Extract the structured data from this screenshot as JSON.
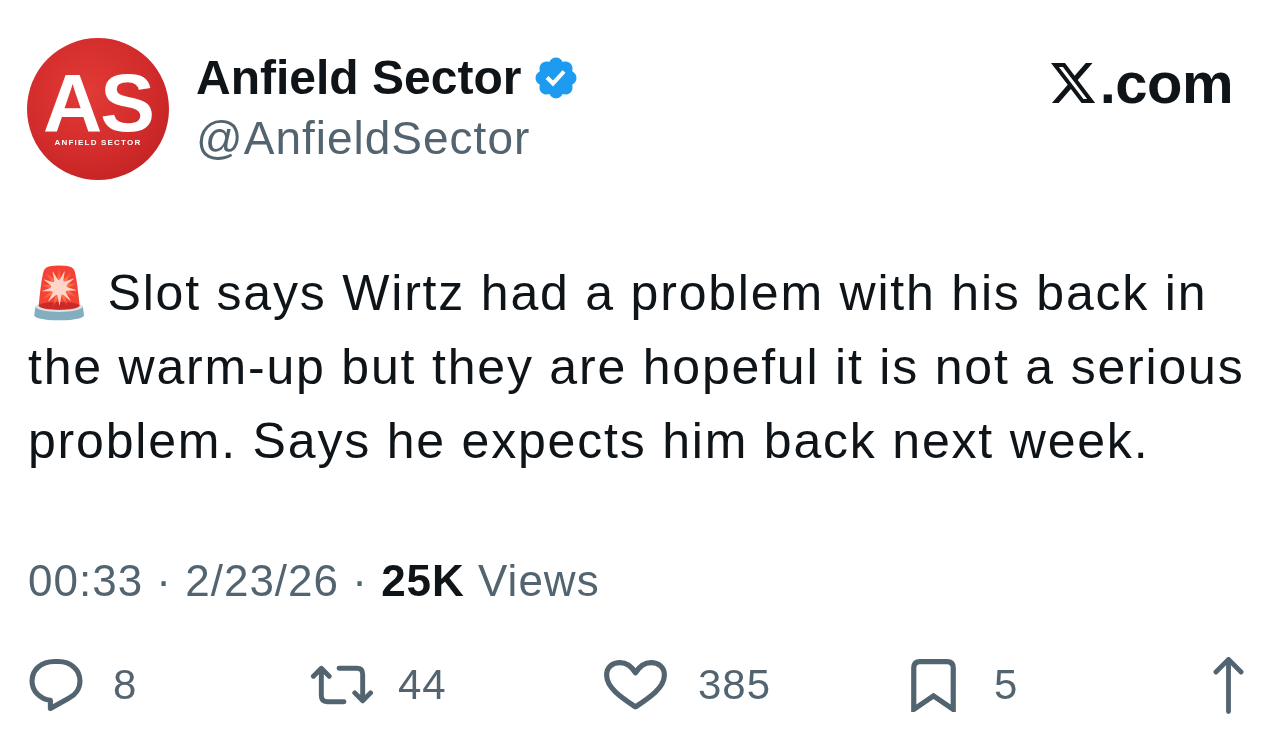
{
  "header": {
    "avatar": {
      "monogram": "AS",
      "caption": "ANFIELD SECTOR"
    },
    "name": "Anfield Sector",
    "verified": true,
    "handle": "@AnfieldSector",
    "site": ".com"
  },
  "tweet": {
    "text": "🚨 Slot says Wirtz had a problem with his back in the warm-up but they are hopeful it is not a serious problem. Says he expects him back next week.",
    "meta": "00:33 · 2/23/26 · **25K** Views"
  },
  "actions": [
    {
      "kind": "reply",
      "count": "8"
    },
    {
      "kind": "repost",
      "count": "44"
    },
    {
      "kind": "like",
      "count": "385"
    },
    {
      "kind": "bookmark",
      "count": "5"
    },
    {
      "kind": "share"
    }
  ]
}
